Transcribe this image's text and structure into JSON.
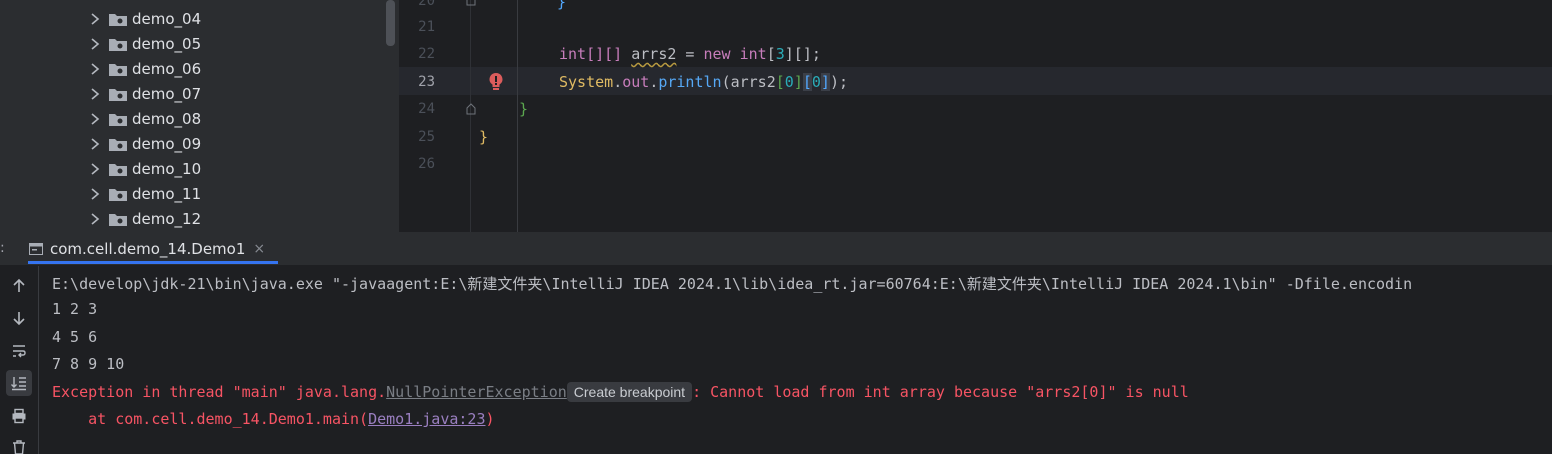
{
  "tree": {
    "items": [
      {
        "label": "demo_04"
      },
      {
        "label": "demo_05"
      },
      {
        "label": "demo_06"
      },
      {
        "label": "demo_07"
      },
      {
        "label": "demo_08"
      },
      {
        "label": "demo_09"
      },
      {
        "label": "demo_10"
      },
      {
        "label": "demo_11"
      },
      {
        "label": "demo_12"
      }
    ]
  },
  "editor": {
    "lines": [
      "21",
      "22",
      "23",
      "24",
      "25",
      "26"
    ],
    "current_line": "23",
    "code": {
      "l20": "}",
      "l22_type": "int[][]",
      "l22_var": "arrs2",
      "l22_eq": " = ",
      "l22_new": "new",
      "l22_type2": "int",
      "l22_dims_open": "[",
      "l22_num": "3",
      "l22_dims_close": "][];",
      "l23_sys": "System",
      "l23_dot1": ".",
      "l23_out": "out",
      "l23_dot2": ".",
      "l23_fn": "println",
      "l23_paren": "(",
      "l23_var": "arrs2",
      "l23_b1o": "[",
      "l23_i1": "0",
      "l23_b1c": "]",
      "l23_b2o": "[",
      "l23_i2": "0",
      "l23_b2c": "]",
      "l23_end": ");",
      "l24": "}",
      "l25": "}"
    }
  },
  "run": {
    "panel_label": ":",
    "tab_label": "com.cell.demo_14.Demo1",
    "tab_close": "×"
  },
  "console": {
    "command": "E:\\develop\\jdk-21\\bin\\java.exe \"-javaagent:E:\\新建文件夹\\IntelliJ IDEA 2024.1\\lib\\idea_rt.jar=60764:E:\\新建文件夹\\IntelliJ IDEA 2024.1\\bin\" -Dfile.encodin",
    "out1": "1 2 3",
    "out2": "4 5 6",
    "out3": "7 8 9 10",
    "err_prefix": "Exception in thread \"main\" java.lang.",
    "err_class": "NullPointerException",
    "err_hint": "Create breakpoint",
    "err_suffix": ": Cannot load from int array because \"arrs2[0]\" is null",
    "trace_prefix": "    at com.cell.demo_14.Demo1.main(",
    "trace_link": "Demo1.java:23",
    "trace_suffix": ")"
  },
  "toolbar": {
    "tools": [
      "arrow-up-icon",
      "arrow-down-icon",
      "soft-wrap-icon",
      "scroll-to-end-icon",
      "print-icon",
      "trash-icon"
    ]
  },
  "colors": {
    "error": "#f75464",
    "accent": "#3574f0"
  }
}
